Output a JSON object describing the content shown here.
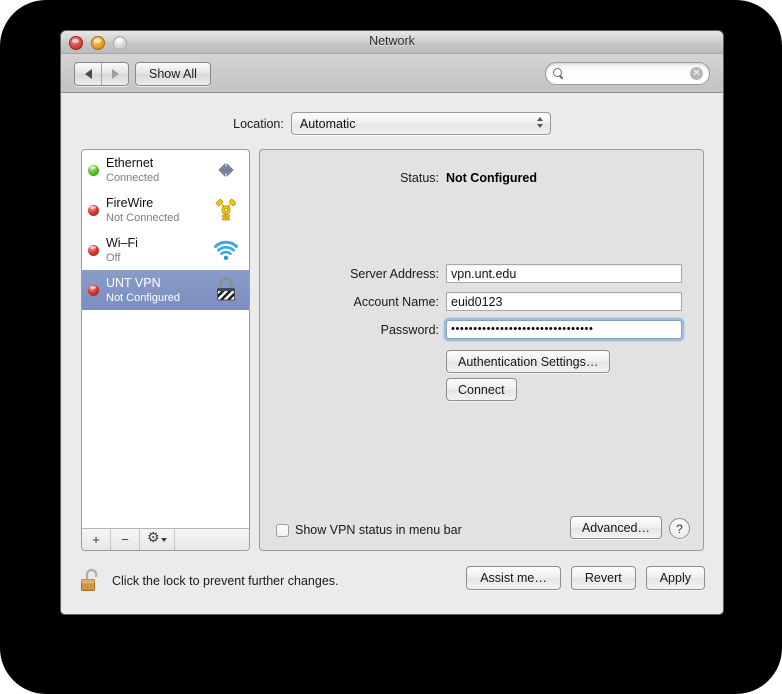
{
  "window": {
    "title": "Network",
    "traffic_lights": [
      "close-button",
      "minimize-button",
      "zoom-button"
    ]
  },
  "toolbar": {
    "back_label": "◀",
    "forward_label": "▶",
    "show_all_label": "Show All",
    "search": {
      "value": "",
      "placeholder": ""
    }
  },
  "location": {
    "label": "Location:",
    "value": "Automatic"
  },
  "sidebar": {
    "services": [
      {
        "name": "Ethernet",
        "status": "Connected",
        "dot": "green",
        "icon": "ethernet-icon"
      },
      {
        "name": "FireWire",
        "status": "Not Connected",
        "dot": "red",
        "icon": "firewire-icon"
      },
      {
        "name": "Wi–Fi",
        "status": "Off",
        "dot": "red",
        "icon": "wifi-icon"
      },
      {
        "name": "UNT VPN",
        "status": "Not Configured",
        "dot": "red",
        "icon": "vpn-lock-icon"
      }
    ],
    "selected_index": 3,
    "toolbar": {
      "add_label": "+",
      "remove_label": "−",
      "action_label": "gear-icon"
    }
  },
  "pane": {
    "status_label": "Status:",
    "status_value": "Not Configured",
    "fields": [
      {
        "label": "Server Address:",
        "value": "vpn.unt.edu",
        "type": "text",
        "focused": false
      },
      {
        "label": "Account Name:",
        "value": "euid0123",
        "type": "text",
        "focused": false
      },
      {
        "label": "Password:",
        "value": "••••••••••••••••••••••••••••••••",
        "type": "password",
        "focused": true
      }
    ],
    "auth_settings_label": "Authentication Settings…",
    "connect_label": "Connect",
    "show_status_label": "Show VPN status in menu bar",
    "show_status_checked": false,
    "advanced_label": "Advanced…",
    "help_label": "?"
  },
  "footer": {
    "lock_text": "Click the lock to prevent further changes.",
    "lock_state": "unlocked",
    "assist_label": "Assist me…",
    "revert_label": "Revert",
    "apply_label": "Apply"
  },
  "colors": {
    "selection": "#7b8ec0",
    "status_connected": "#5cc22a",
    "status_disconnected": "#d8362c",
    "focus_ring": "#6ea0d7",
    "window_bg": "#ebebeb",
    "pane_bg": "#e2e2e2"
  }
}
